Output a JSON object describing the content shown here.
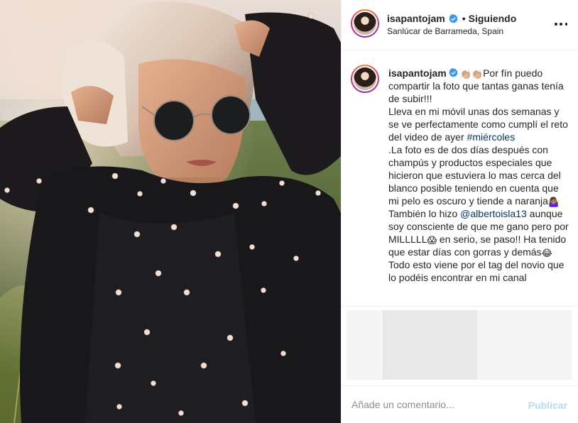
{
  "post": {
    "username": "isapantojam",
    "following_label": "Siguiendo",
    "location": "Sanlúcar de Barrameda, Spain"
  },
  "caption": {
    "username": "isapantojam",
    "clap_emoji": "👏🏼👏🏼",
    "line_1": "Por fín puedo compartir la foto que tantas ganas tenía de subir!!!",
    "line_2a": "Lleva en mi móvil unas dos semanas y se ve perfectamente como cumplí el reto del video de ayer ",
    "hashtag": "#miércoles",
    "line_3a": ".La foto es de dos días después con champús y productos especiales que hicieron que estuviera lo mas cerca del blanco posible teniendo en cuenta que mi pelo es oscuro y tiende a naranja",
    "shrug_emoji": "🤷🏽‍♀️",
    "line_3b": "También lo hizo ",
    "mention": "@albertoisla13",
    "line_3c": " aunque soy consciente de que me gano pero por MILLLLL",
    "scream_emoji": "😱",
    "line_3d": " en serio, se paso!! Ha tenido que estar días con gorras y demás",
    "joy_emoji": "😂",
    "line_4": "Todo esto viene por el tag del novio que lo podéis encontrar en mi canal"
  },
  "comment": {
    "placeholder": "Añade un comentario...",
    "publish_label": "Publicar"
  },
  "icons": {
    "verified": "verified-badge-icon",
    "more": "more-options-icon"
  },
  "colors": {
    "verified_blue": "#3897f0",
    "link_blue": "#00376b",
    "publish_disabled": "#b3dbff",
    "placeholder_gray": "#8e8e8e"
  }
}
